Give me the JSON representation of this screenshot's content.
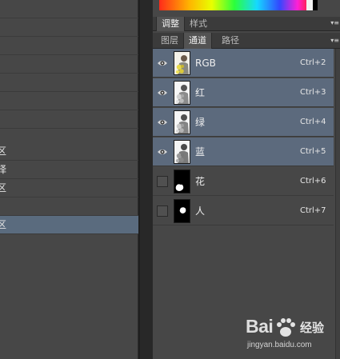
{
  "history_panel": {
    "rows": [
      {
        "label": "",
        "selected": false
      },
      {
        "label": "",
        "selected": false
      },
      {
        "label": "",
        "selected": false
      },
      {
        "label": "",
        "selected": false
      },
      {
        "label": "",
        "selected": false
      },
      {
        "label": "",
        "selected": false
      },
      {
        "label": "",
        "selected": false
      },
      {
        "label": "区",
        "selected": false
      },
      {
        "label": "择",
        "selected": false
      },
      {
        "label": "区",
        "selected": false
      },
      {
        "label": "",
        "selected": false
      },
      {
        "label": "区",
        "selected": true
      }
    ]
  },
  "panel_tabs_top": [
    {
      "label": "调整",
      "active": true
    },
    {
      "label": "样式",
      "active": false
    }
  ],
  "panel_tabs": [
    {
      "label": "图层",
      "active": false
    },
    {
      "label": "通道",
      "active": true
    },
    {
      "label": "路径",
      "active": false
    }
  ],
  "channels": [
    {
      "name": "RGB",
      "shortcut": "Ctrl+2",
      "visible": true,
      "selected": true,
      "thumb": "color-photo",
      "icon": "eye-icon"
    },
    {
      "name": "红",
      "shortcut": "Ctrl+3",
      "visible": true,
      "selected": true,
      "thumb": "gray-photo",
      "icon": "eye-icon"
    },
    {
      "name": "绿",
      "shortcut": "Ctrl+4",
      "visible": true,
      "selected": true,
      "thumb": "gray-photo",
      "icon": "eye-icon"
    },
    {
      "name": "蓝",
      "shortcut": "Ctrl+5",
      "visible": true,
      "selected": true,
      "thumb": "gray-photo",
      "icon": "eye-icon"
    },
    {
      "name": "花",
      "shortcut": "Ctrl+6",
      "visible": false,
      "selected": false,
      "thumb": "mask-flower",
      "icon": "empty-visibility-box"
    },
    {
      "name": "人",
      "shortcut": "Ctrl+7",
      "visible": false,
      "selected": false,
      "thumb": "mask-person",
      "icon": "empty-visibility-box"
    }
  ],
  "watermark": {
    "logo": "Bai",
    "brand": "经验",
    "url": "jingyan.baidu.com"
  },
  "colors": {
    "selected_row": "#5c6a7d",
    "panel_bg": "#474747",
    "tab_active": "#535353"
  }
}
